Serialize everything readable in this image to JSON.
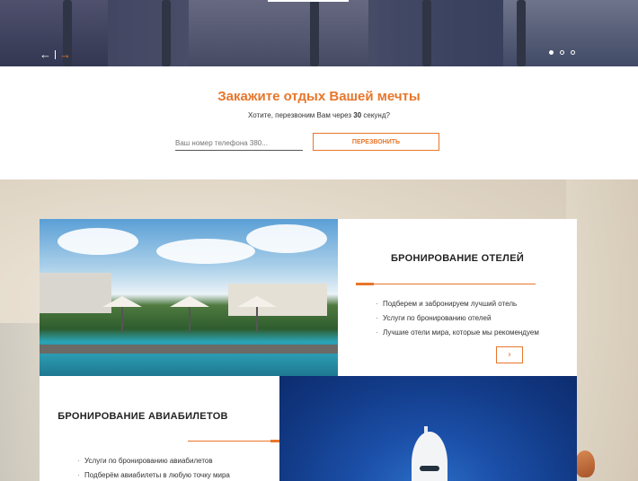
{
  "hero": {
    "prev_arrow": "←",
    "next_arrow": "→",
    "slides": [
      true,
      false,
      false
    ]
  },
  "cta": {
    "title": "Закажите отдых Вашей мечты",
    "subtitle_before": "Хотите, перезвоним Вам через ",
    "subtitle_bold": "30",
    "subtitle_after": " секунд?",
    "phone_placeholder": "Ваш номер телефона 380...",
    "call_button": "ПЕРЕЗВОНИТЬ"
  },
  "hotels": {
    "title": "БРОНИРОВАНИЕ ОТЕЛЕЙ",
    "items": [
      "Подберем и забронируем лучший отель",
      "Услуги по бронированию отелей",
      "Лучшие отели мира, которые мы рекомендуем"
    ],
    "more_icon": "›"
  },
  "flights": {
    "title": "БРОНИРОВАНИЕ АВИАБИЛЕТОВ",
    "items": [
      "Услуги по бронированию авиабилетов",
      "Подберём авиабилеты в любую точку мира"
    ]
  },
  "colors": {
    "accent": "#e8762c",
    "text": "#222222"
  }
}
